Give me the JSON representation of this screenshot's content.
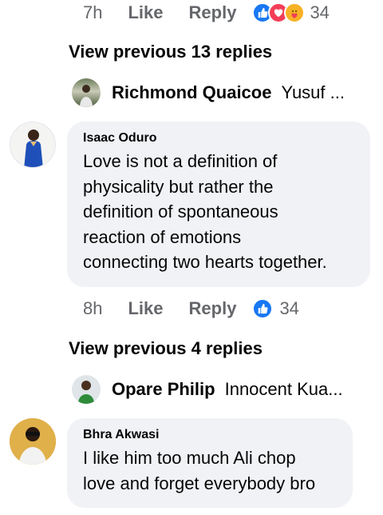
{
  "comment_top": {
    "time": "7h",
    "like_label": "Like",
    "reply_label": "Reply",
    "reaction_count": "34",
    "reaction_icons": [
      "like-icon",
      "love-icon",
      "care-icon"
    ]
  },
  "view_prev_1": {
    "label": "View previous 13 replies"
  },
  "reply_preview_1": {
    "name": "Richmond Quaicoe",
    "snippet": "Yusuf ..."
  },
  "comment_2": {
    "author": "Isaac Oduro",
    "text": "Love is not a definition of\nphysicality but rather the\ndefinition of spontaneous\nreaction of emotions\nconnecting two hearts together.",
    "time": "8h",
    "like_label": "Like",
    "reply_label": "Reply",
    "reaction_count": "34",
    "reaction_icons": [
      "like-icon"
    ]
  },
  "view_prev_2": {
    "label": "View previous 4 replies"
  },
  "reply_preview_2": {
    "name": "Opare Philip",
    "snippet": "Innocent Kua..."
  },
  "comment_3": {
    "author": "Bhra Akwasi",
    "text": "I like him too much Ali chop\nlove and forget everybody bro"
  },
  "colors": {
    "text": "#050505",
    "meta": "#65676b",
    "bubble": "#f0f2f5",
    "like_blue": "#1877f2",
    "love_red": "#f33e58",
    "care_yellow": "#f7b125"
  }
}
